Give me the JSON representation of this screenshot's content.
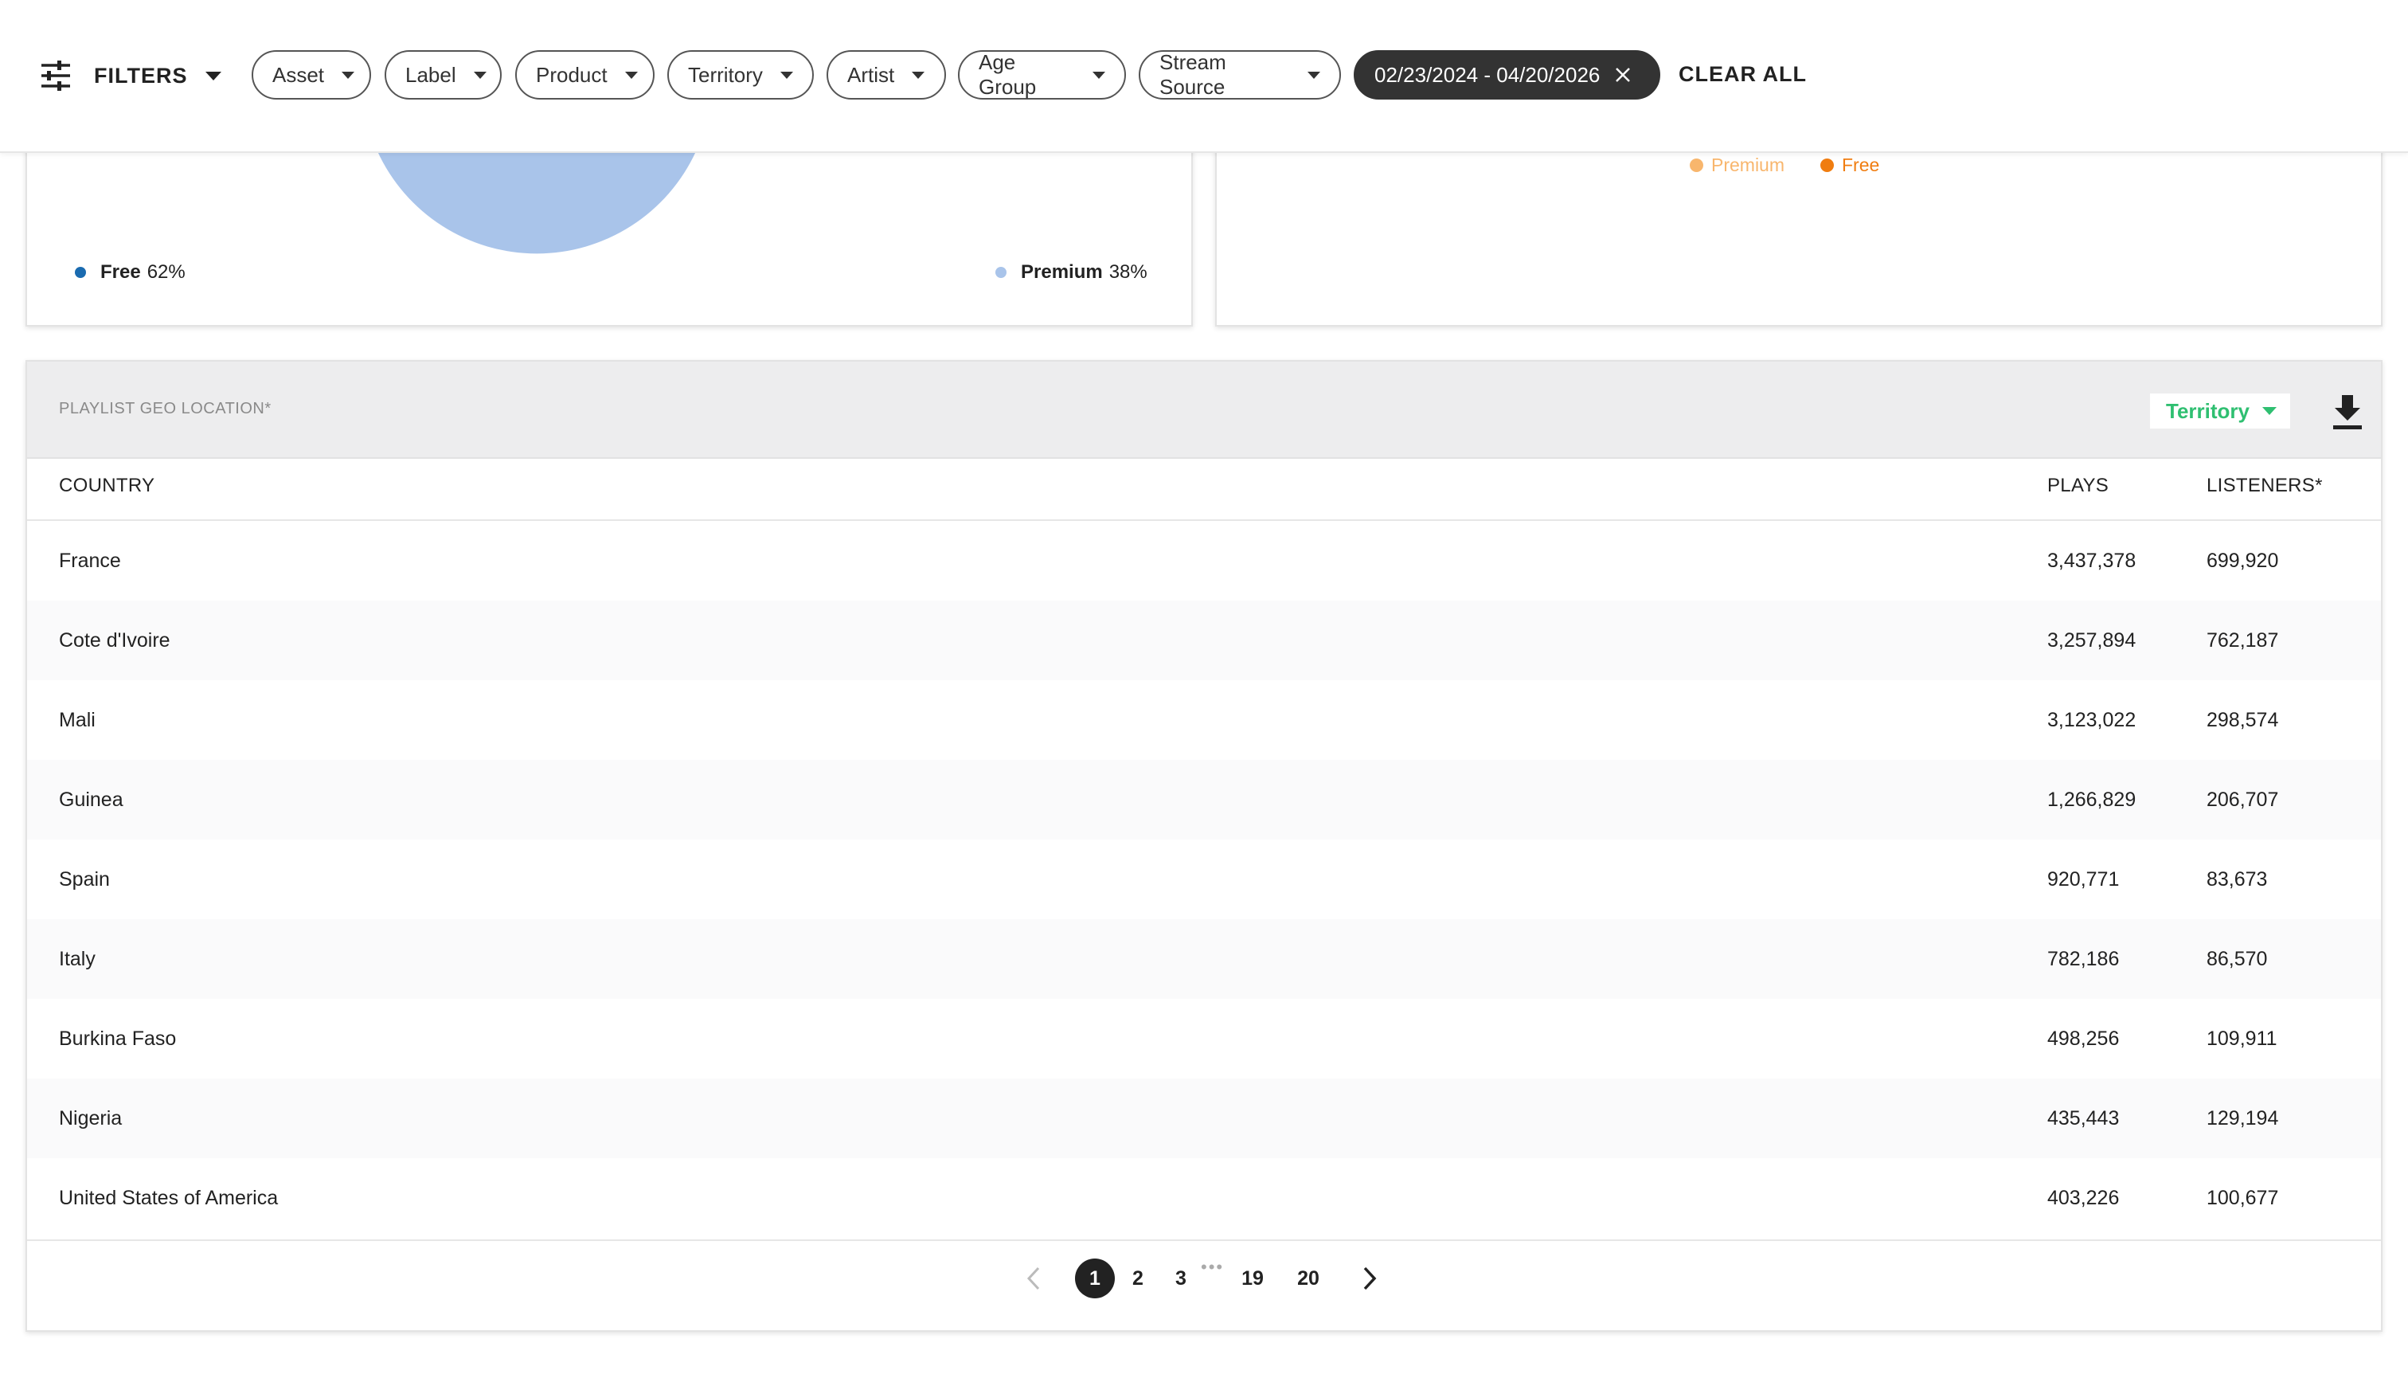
{
  "filters": {
    "toggle_label": "FILTERS",
    "chips": [
      {
        "label": "Asset"
      },
      {
        "label": "Label"
      },
      {
        "label": "Product"
      },
      {
        "label": "Territory"
      },
      {
        "label": "Artist"
      },
      {
        "label": "Age Group"
      },
      {
        "label": "Stream Source"
      }
    ],
    "date_range": "02/23/2024 - 04/20/2026",
    "clear_all": "CLEAR ALL"
  },
  "pie_card": {
    "legend": [
      {
        "name": "Free",
        "value": "62%",
        "color": "#1a6bb0"
      },
      {
        "name": "Premium",
        "value": "38%",
        "color": "#a9c4ea"
      }
    ]
  },
  "bar_card": {
    "legend": [
      {
        "name": "Premium",
        "color": "#f8b66d"
      },
      {
        "name": "Free",
        "color": "#f07d10"
      }
    ]
  },
  "table": {
    "title": "PLAYLIST GEO LOCATION*",
    "dimension_selector": "Territory",
    "columns": {
      "country": "COUNTRY",
      "plays": "PLAYS",
      "listeners": "LISTENERS*"
    },
    "rows": [
      {
        "country": "France",
        "plays": "3,437,378",
        "listeners": "699,920"
      },
      {
        "country": "Cote d'Ivoire",
        "plays": "3,257,894",
        "listeners": "762,187"
      },
      {
        "country": "Mali",
        "plays": "3,123,022",
        "listeners": "298,574"
      },
      {
        "country": "Guinea",
        "plays": "1,266,829",
        "listeners": "206,707"
      },
      {
        "country": "Spain",
        "plays": "920,771",
        "listeners": "83,673"
      },
      {
        "country": "Italy",
        "plays": "782,186",
        "listeners": "86,570"
      },
      {
        "country": "Burkina Faso",
        "plays": "498,256",
        "listeners": "109,911"
      },
      {
        "country": "Nigeria",
        "plays": "435,443",
        "listeners": "129,194"
      },
      {
        "country": "United States of America",
        "plays": "403,226",
        "listeners": "100,677"
      }
    ]
  },
  "pagination": {
    "pages": [
      "1",
      "2",
      "3",
      "19",
      "20"
    ],
    "current": "1",
    "ellipsis": "•••"
  },
  "colors": {
    "accent_green": "#2fbf71",
    "chip_active_bg": "#333333"
  }
}
